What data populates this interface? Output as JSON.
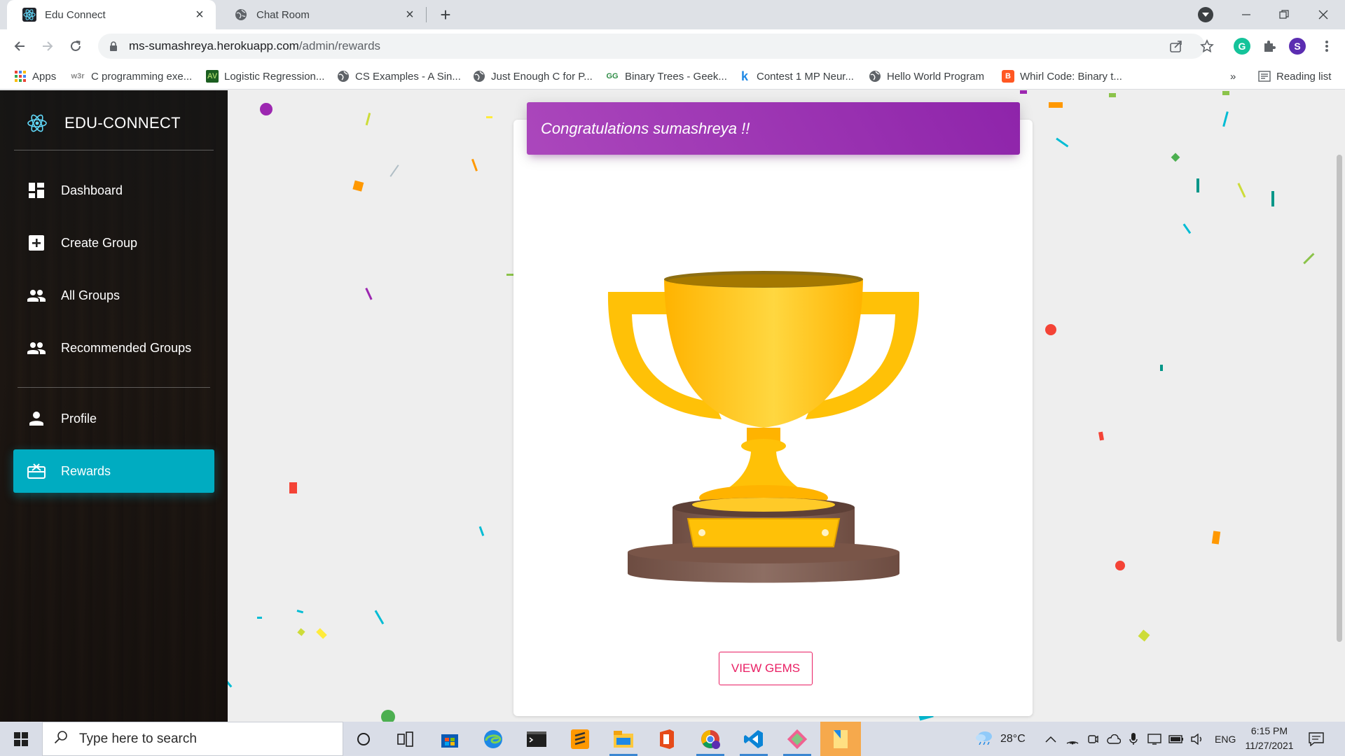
{
  "browser": {
    "tabs": [
      {
        "title": "Edu Connect",
        "icon": "react-icon"
      },
      {
        "title": "Chat Room",
        "icon": "globe-icon"
      }
    ],
    "url_host": "ms-sumashreya.herokuapp.com",
    "url_path": "/admin/rewards",
    "profile_initial": "S",
    "reading_list": "Reading list",
    "bookmarks": [
      {
        "label": "Apps",
        "icon": "apps-grid-icon"
      },
      {
        "label": "C programming exe...",
        "icon": "w3r-icon"
      },
      {
        "label": "Logistic Regression...",
        "icon": "analytics-icon"
      },
      {
        "label": "CS Examples - A Sin...",
        "icon": "globe-icon"
      },
      {
        "label": "Just Enough C for P...",
        "icon": "globe-icon"
      },
      {
        "label": "Binary Trees - Geek...",
        "icon": "gfg-icon"
      },
      {
        "label": "Contest 1 MP Neur...",
        "icon": "k-icon"
      },
      {
        "label": "Hello World Program",
        "icon": "globe-icon"
      },
      {
        "label": "Whirl Code: Binary t...",
        "icon": "blogger-icon"
      }
    ]
  },
  "sidebar": {
    "brand": "EDU-CONNECT",
    "items": [
      {
        "label": "Dashboard",
        "icon": "dashboard-icon",
        "active": false
      },
      {
        "label": "Create Group",
        "icon": "add-box-icon",
        "active": false
      },
      {
        "label": "All Groups",
        "icon": "people-icon",
        "active": false
      },
      {
        "label": "Recommended Groups",
        "icon": "people-icon",
        "active": false
      },
      {
        "label": "Profile",
        "icon": "person-icon",
        "active": false
      },
      {
        "label": "Rewards",
        "icon": "gift-card-icon",
        "active": true
      }
    ]
  },
  "main": {
    "header": "Congratulations sumashreya !!",
    "button_label": "VIEW GEMS"
  },
  "colors": {
    "accent": "#00acc1",
    "header_gradient_start": "#ab47bc",
    "header_gradient_end": "#8e24aa",
    "button": "#e91e63",
    "trophy_gold": "#ffc107",
    "trophy_base": "#795548"
  },
  "taskbar": {
    "search_placeholder": "Type here to search",
    "weather": "28°C",
    "language": "ENG",
    "time": "6:15 PM",
    "date": "11/27/2021"
  }
}
